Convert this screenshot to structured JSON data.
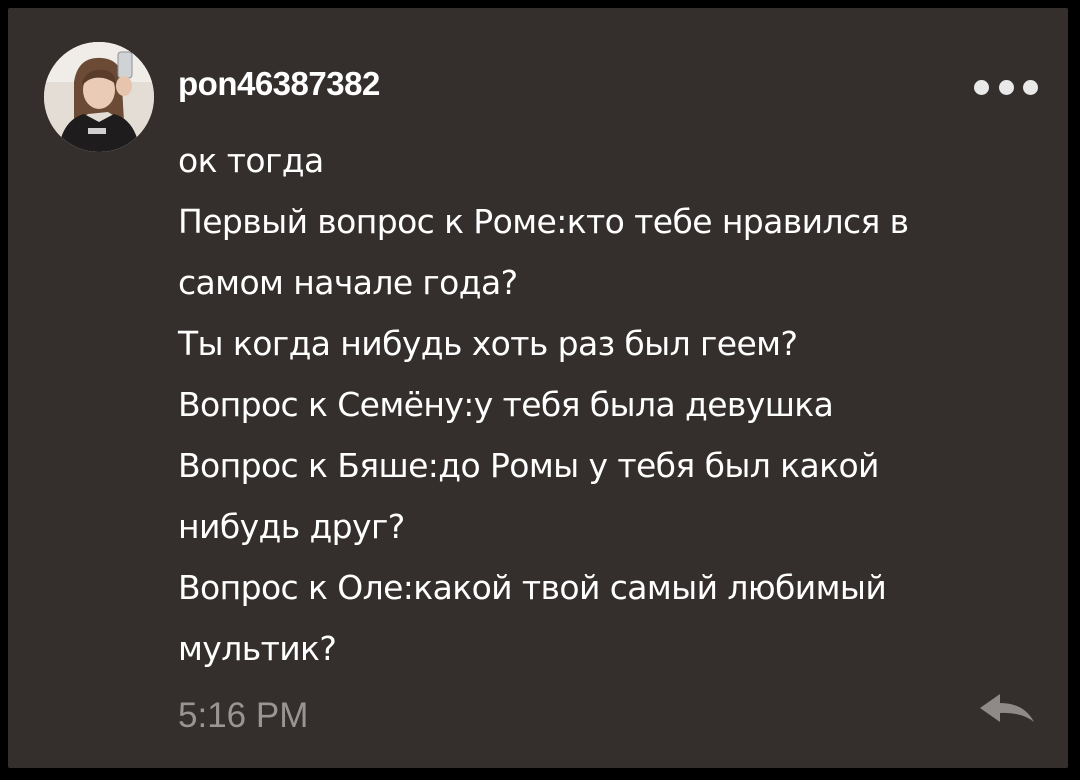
{
  "post": {
    "username": "pon46387382",
    "avatar_icon": "avatar-photo",
    "more_icon": "more-dots-icon",
    "lines": [
      "ок тогда",
      "Первый вопрос к Роме:кто тебе нравился в",
      "самом начале года?",
      "Ты когда нибудь хоть раз был геем?",
      "Вопрос к Семёну:у тебя была девушка",
      "Вопрос к Бяше:до Ромы у тебя был какой",
      "нибудь друг?",
      "Вопрос к Оле:какой твой самый любимый",
      "мультик?"
    ],
    "time": "5:16 PM",
    "reply_icon": "reply-arrow-icon"
  },
  "colors": {
    "background": "#000000",
    "card": "#342f2d",
    "text": "#ffffff",
    "muted": "#9a9593"
  }
}
